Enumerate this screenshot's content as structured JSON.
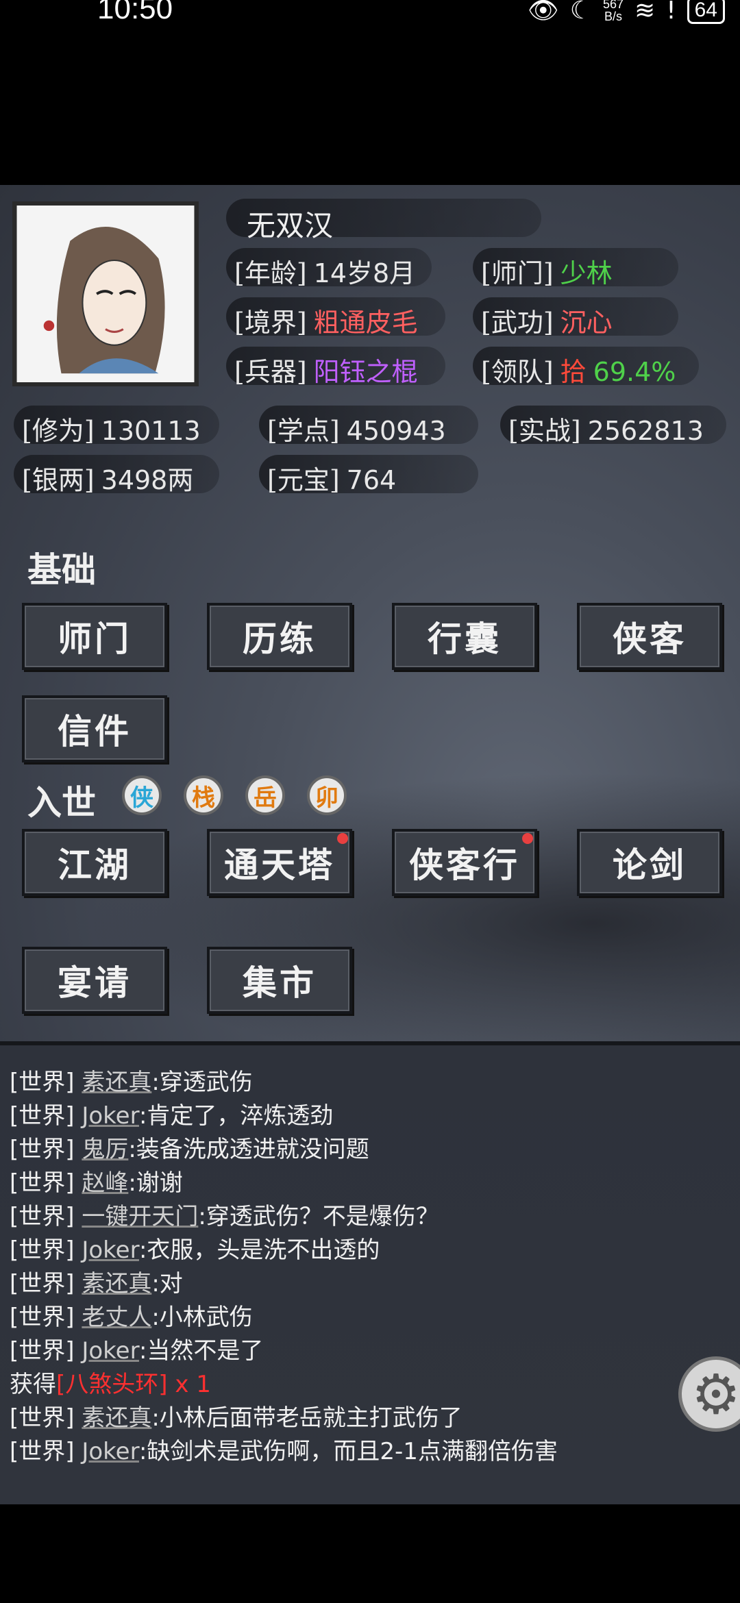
{
  "status_bar": {
    "time": "10:50",
    "net_speed_top": "567",
    "net_speed_bottom": "B/s",
    "battery": "64"
  },
  "character": {
    "name": "无双汉",
    "stats": [
      {
        "key": "[年龄]",
        "value": "14岁8月",
        "color": "#e8e8e8"
      },
      {
        "key": "[师门]",
        "value": "少林",
        "color": "#4fd14a"
      },
      {
        "key": "[境界]",
        "value": "粗通皮毛",
        "color": "#ff6060"
      },
      {
        "key": "[武功]",
        "value": "沉心",
        "color": "#ff6060"
      },
      {
        "key": "[兵器]",
        "value": "阳钰之棍",
        "color": "#c060ff"
      },
      {
        "key": "[领队]",
        "value_a": "拾",
        "value_b": "69.4%",
        "color_a": "#ff4a3a",
        "color_b": "#4fd14a"
      }
    ],
    "resources": [
      {
        "key": "[修为]",
        "value": "130113"
      },
      {
        "key": "[学点]",
        "value": "450943"
      },
      {
        "key": "[实战]",
        "value": "2562813"
      },
      {
        "key": "[银两]",
        "value": "3498两"
      },
      {
        "key": "[元宝]",
        "value": "764"
      }
    ]
  },
  "basic": {
    "title": "基础",
    "buttons": [
      "师门",
      "历练",
      "行囊",
      "侠客",
      "信件"
    ]
  },
  "world": {
    "title": "入世",
    "badges": [
      {
        "char": "侠",
        "color": "#2aa6d6"
      },
      {
        "char": "栈",
        "color": "#e07a10"
      },
      {
        "char": "岳",
        "color": "#e07a10"
      },
      {
        "char": "卯",
        "color": "#e07a10"
      }
    ],
    "buttons": [
      "江湖",
      "通天塔",
      "侠客行",
      "论剑",
      "宴请",
      "集市"
    ]
  },
  "chat": [
    {
      "prefix": "[世界]",
      "user": "素还真",
      "text": ":穿透武伤"
    },
    {
      "prefix": "[世界]",
      "user": "Joker",
      "text": ":肯定了，淬炼透劲"
    },
    {
      "prefix": "[世界]",
      "user": "鬼厉",
      "text": ":装备洗成透进就没问题"
    },
    {
      "prefix": "[世界]",
      "user": "赵峰",
      "text": ":谢谢"
    },
    {
      "prefix": "[世界]",
      "user": "一键开天门",
      "text": ":穿透武伤？不是爆伤？"
    },
    {
      "prefix": "[世界]",
      "user": "Joker",
      "text": ":衣服，头是洗不出透的"
    },
    {
      "prefix": "[世界]",
      "user": "素还真",
      "text": ":对"
    },
    {
      "prefix": "[世界]",
      "user": "老丈人",
      "text": ":小林武伤"
    },
    {
      "prefix": "[世界]",
      "user": "Joker",
      "text": ":当然不是了"
    },
    {
      "prefix": "获得",
      "item": "[八煞头环]",
      "count": " x 1"
    },
    {
      "prefix": "[世界]",
      "user": "素还真",
      "text": ":小林后面带老岳就主打武伤了"
    },
    {
      "prefix": "[世界]",
      "user": "Joker",
      "text": ":缺剑术是武伤啊，而且2-1点满翻倍伤害"
    }
  ]
}
